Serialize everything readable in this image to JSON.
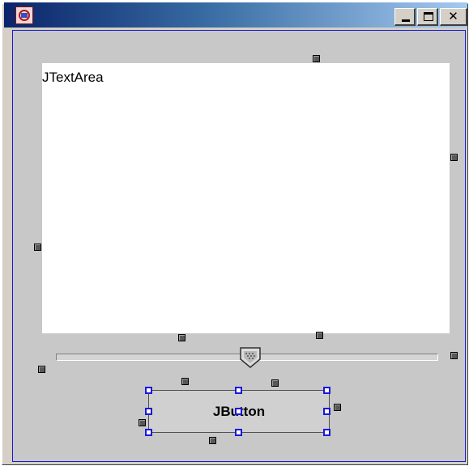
{
  "window": {
    "app_icon": "java-duke-icon",
    "title": "",
    "controls": {
      "minimize_icon": "minimize-icon",
      "maximize_icon": "maximize-icon",
      "close_icon": "close-icon",
      "close_glyph": "✕"
    }
  },
  "designer": {
    "text_area_label": "JTextArea",
    "slider_value_percent": 51,
    "button_label": "JButton",
    "selected_component": "JButton"
  },
  "colors": {
    "titlebar_start": "#0a246a",
    "titlebar_end": "#a6caf0",
    "content_border": "#1818d0",
    "selection_handle": "#1818e0",
    "background": "#c8c8c8"
  }
}
